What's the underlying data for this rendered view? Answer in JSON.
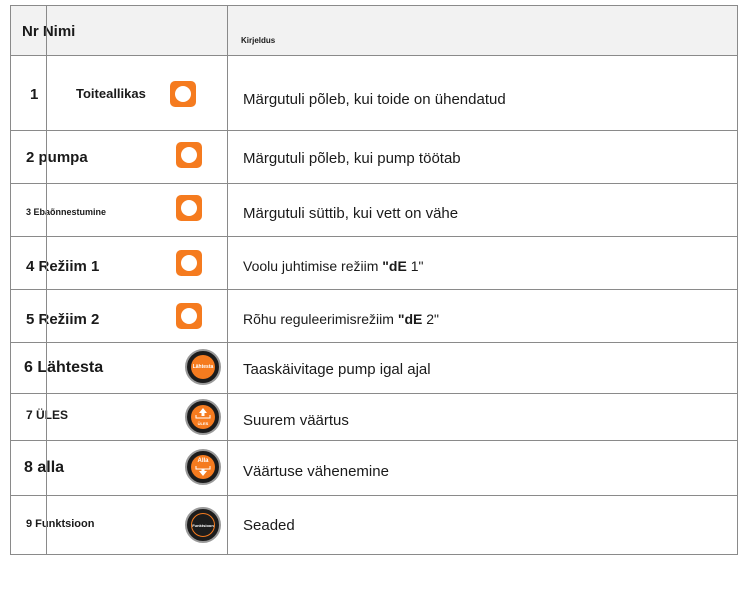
{
  "header": {
    "col1": "Nr Nimi",
    "col2": "Kirjeldus"
  },
  "rows": [
    {
      "name": "1",
      "label": "Toiteallikas",
      "desc": "Märgutuli põleb, kui toide on ühendatud"
    },
    {
      "name": "2 pumpa",
      "desc": "Märgutuli põleb, kui pump töötab"
    },
    {
      "name": "3 Ebaõnnestumine",
      "desc": "Märgutuli süttib, kui vett on vähe"
    },
    {
      "name": "4 Režiim 1",
      "desc_pre": "Voolu juhtimise režiim ",
      "desc_bold": "\"dE",
      "desc_post": " 1\""
    },
    {
      "name": "5 Režiim 2",
      "desc_pre": "Rõhu reguleerimisrežiim ",
      "desc_bold": "\"dE",
      "desc_post": " 2\""
    },
    {
      "name": "6 Lähtesta",
      "button": "Lähtesta",
      "desc": "Taaskäivitage pump igal ajal"
    },
    {
      "name": "7 ÜLES",
      "button": "ÜLES",
      "desc": "Suurem väärtus"
    },
    {
      "name": "8 alla",
      "button": "Alla",
      "desc": "Väärtuse vähenemine"
    },
    {
      "name": "9 Funktsioon",
      "button": "Funktsioon",
      "desc": "Seaded"
    }
  ],
  "icons": {
    "indicator": "orange-indicator-light-icon",
    "button": "round-control-button-icon"
  },
  "colors": {
    "accent": "#f57b1f",
    "button_body": "#1c1c1c"
  }
}
